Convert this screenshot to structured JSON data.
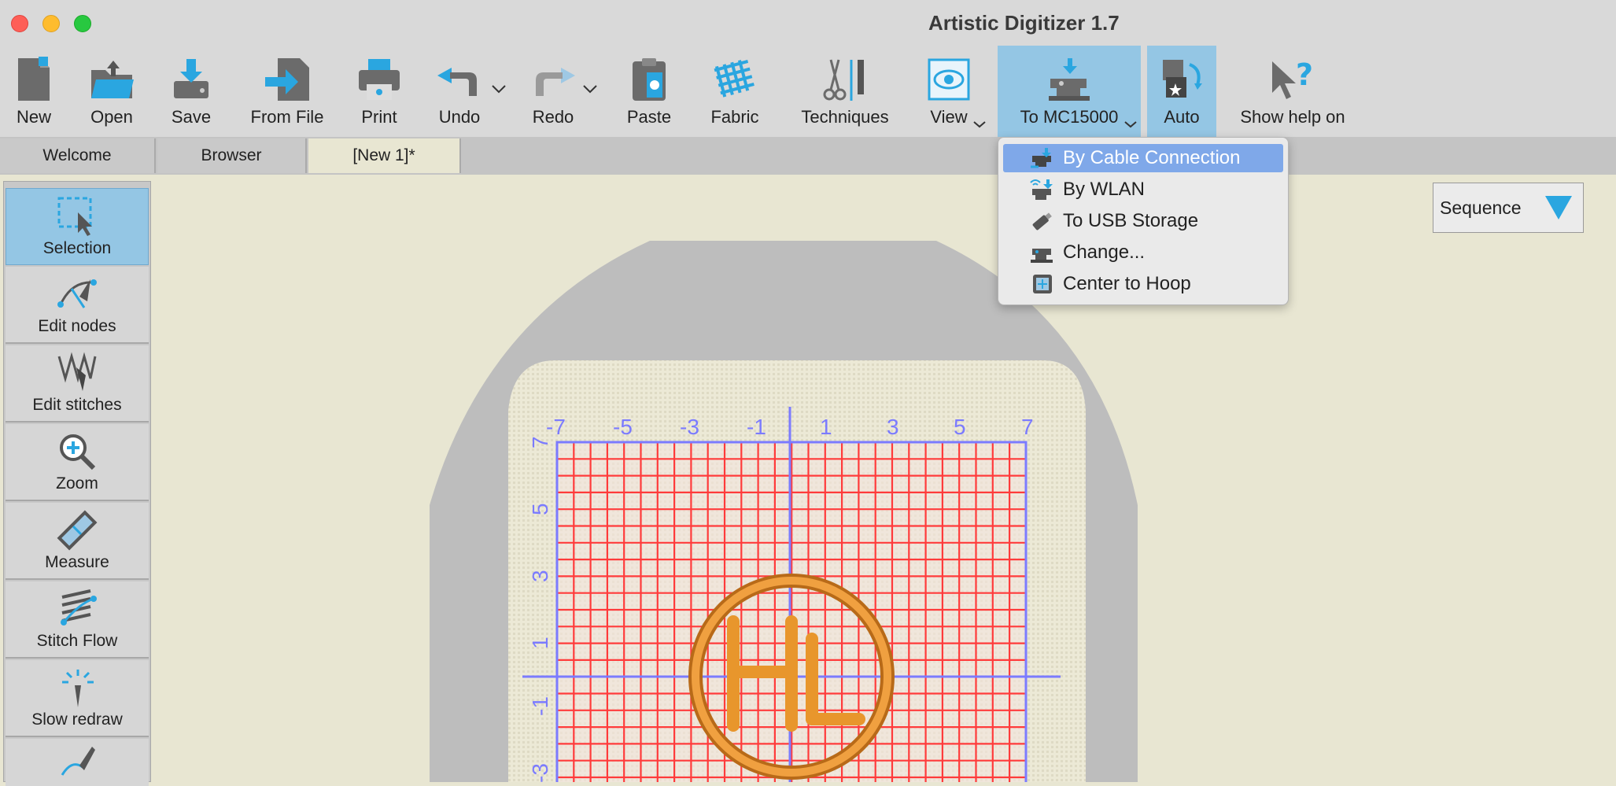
{
  "window": {
    "title": "Artistic Digitizer 1.7"
  },
  "toolbar": {
    "new": "New",
    "open": "Open",
    "save": "Save",
    "from_file": "From File",
    "print": "Print",
    "undo": "Undo",
    "redo": "Redo",
    "paste": "Paste",
    "fabric": "Fabric",
    "techniques": "Techniques",
    "view": "View",
    "to_machine": "To MC15000",
    "auto": "Auto",
    "show_help": "Show help on"
  },
  "tabs": [
    "Welcome",
    "Browser",
    "[New 1]*"
  ],
  "left_tools": [
    "Selection",
    "Edit nodes",
    "Edit stitches",
    "Zoom",
    "Measure",
    "Stitch Flow",
    "Slow redraw"
  ],
  "sequence": {
    "label": "Sequence"
  },
  "menu": {
    "items": [
      "By Cable Connection",
      "By WLAN",
      "To USB Storage",
      "Change...",
      "Center to Hoop"
    ],
    "highlighted": "By Cable Connection"
  },
  "ruler": {
    "x_labels": [
      "-7",
      "-5",
      "-3",
      "-1",
      "1",
      "3",
      "5",
      "7"
    ],
    "y_labels": [
      "7",
      "5",
      "3",
      "1",
      "-1",
      "-3"
    ]
  },
  "design": {
    "letters": "HL"
  },
  "colors": {
    "accent": "#94c6e4",
    "grid": "#ff3b3b",
    "axis": "#7b7bff",
    "design": "#e8962c",
    "menu_highlight": "#7fa8e9"
  }
}
